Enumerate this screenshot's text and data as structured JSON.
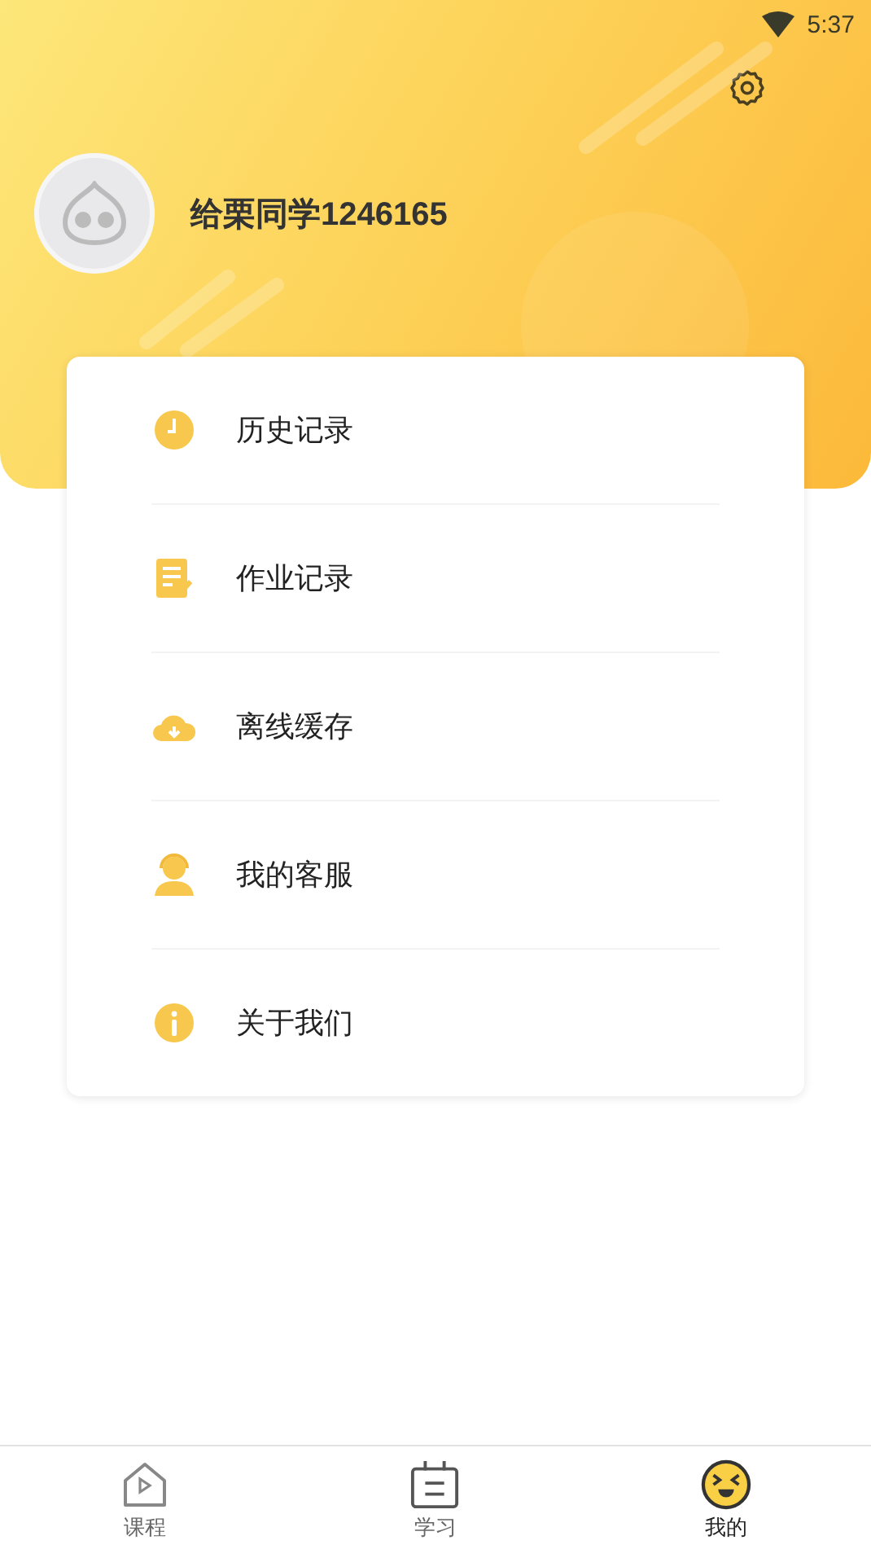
{
  "status_bar": {
    "time": "5:37"
  },
  "profile": {
    "name": "给栗同学1246165"
  },
  "menu": [
    {
      "kind": "history",
      "label": "历史记录"
    },
    {
      "kind": "homework",
      "label": "作业记录"
    },
    {
      "kind": "cache",
      "label": "离线缓存"
    },
    {
      "kind": "service",
      "label": "我的客服"
    },
    {
      "kind": "about",
      "label": "关于我们"
    }
  ],
  "tabs": [
    {
      "kind": "course",
      "label": "课程",
      "selected": false
    },
    {
      "kind": "study",
      "label": "学习",
      "selected": false
    },
    {
      "kind": "me",
      "label": "我的",
      "selected": true
    }
  ]
}
